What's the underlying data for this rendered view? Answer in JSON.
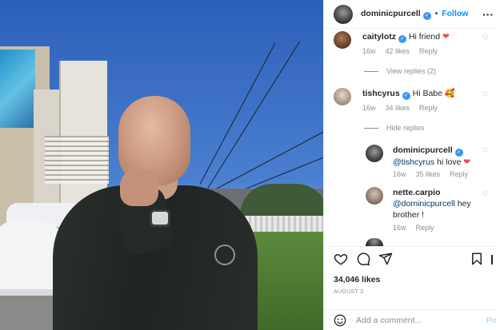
{
  "post": {
    "author": "dominicpurcell",
    "follow_label": "Follow",
    "more_icon": "more-horizontal-icon",
    "likes_text": "34,046 likes",
    "date": "AUGUST 3"
  },
  "comments": [
    {
      "username": "caitylotz",
      "text": "Hi friend",
      "emoji": "❤",
      "age": "16w",
      "likes": "42 likes",
      "reply_label": "Reply",
      "toggle": "View replies (2)"
    },
    {
      "username": "tishcyrus",
      "text": "Hi Babe",
      "emoji": "🥰",
      "age": "16w",
      "likes": "34 likes",
      "reply_label": "Reply",
      "toggle": "Hide replies"
    }
  ],
  "replies": [
    {
      "username": "dominicpurcell",
      "mention": "@tishcyrus",
      "text": "hi love",
      "emoji": "❤",
      "age": "16w",
      "likes": "35 likes",
      "reply_label": "Reply"
    },
    {
      "username": "nette.carpio",
      "mention": "@dominicpurcell",
      "text": "hey brother !",
      "age": "16w",
      "reply_label": "Reply"
    }
  ],
  "composer": {
    "placeholder": "Add a comment...",
    "post_label": "Po"
  },
  "icons": {
    "heart": "heart-icon",
    "comment": "comment-icon",
    "share": "share-icon",
    "save": "bookmark-icon",
    "emoji": "emoji-icon"
  },
  "colors": {
    "link_blue": "#0095f6",
    "verified_blue": "#3897f0",
    "like_red": "#ed4956",
    "muted": "#8e8e8e"
  }
}
